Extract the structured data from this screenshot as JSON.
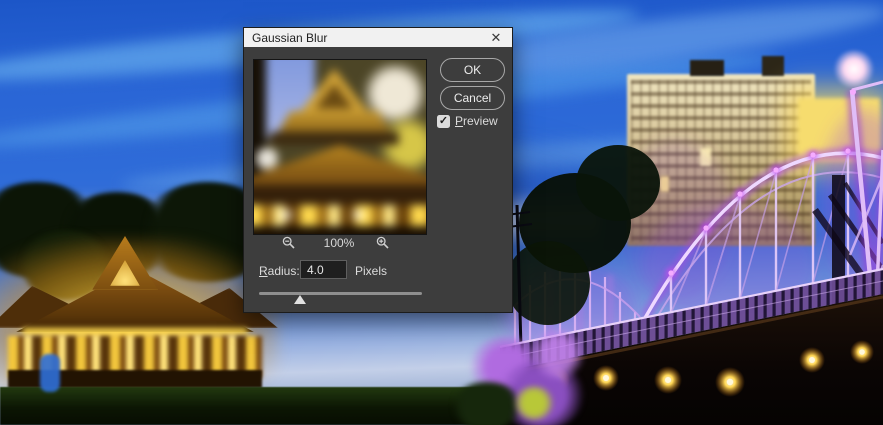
{
  "window": {
    "title": "Gaussian Blur",
    "close_glyph": "✕"
  },
  "dialog": {
    "ok_label": "OK",
    "cancel_label": "Cancel",
    "preview": {
      "label": "Preview",
      "checked": true,
      "check_glyph": "✓"
    },
    "zoom": {
      "level": "100%"
    },
    "radius": {
      "label": "Radius:",
      "value": "4.0",
      "unit": "Pixels",
      "slider_handle_style": "left: calc(21% - 6px)"
    }
  },
  "colors": {
    "dialog_body": "#3d3d3d",
    "titlebar_bg": "#f1f1f1",
    "button_border": "#a8a8a8",
    "bridge_purple": "#c77dff",
    "pavilion_gold": "#f7c63e",
    "sky_blue": "#2a66d6"
  }
}
